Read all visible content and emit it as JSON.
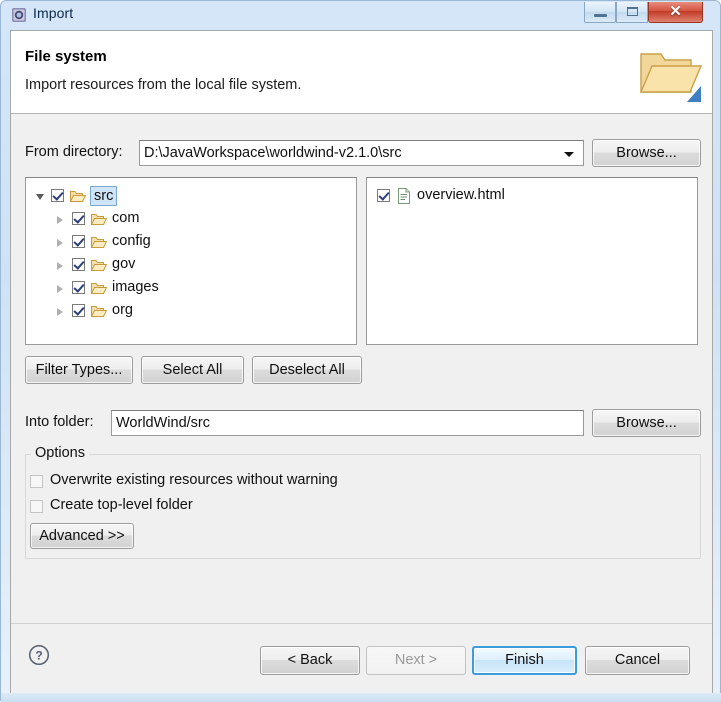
{
  "window": {
    "title": "Import",
    "icon": "import-wizard-icon",
    "controls": {
      "minimize": "minimize-button",
      "maximize": "maximize-button",
      "close_glyph": "✕"
    }
  },
  "header": {
    "title": "File system",
    "description": "Import resources from the local file system.",
    "icon": "open-folder-import-icon"
  },
  "source": {
    "label": "From directory:",
    "value": "D:\\JavaWorkspace\\worldwind-v2.1.0\\src",
    "placeholder": "",
    "browse_label": "Browse..."
  },
  "tree": {
    "items": [
      {
        "label": "src",
        "indent": 0,
        "checked": true,
        "expanded": true,
        "selected": true
      },
      {
        "label": "com",
        "indent": 1,
        "checked": true,
        "expanded": false,
        "selected": false
      },
      {
        "label": "config",
        "indent": 1,
        "checked": true,
        "expanded": false,
        "selected": false
      },
      {
        "label": "gov",
        "indent": 1,
        "checked": true,
        "expanded": false,
        "selected": false
      },
      {
        "label": "images",
        "indent": 1,
        "checked": true,
        "expanded": false,
        "selected": false
      },
      {
        "label": "org",
        "indent": 1,
        "checked": true,
        "expanded": false,
        "selected": false
      }
    ]
  },
  "file_list": {
    "items": [
      {
        "label": "overview.html",
        "checked": true
      }
    ]
  },
  "filter_buttons": {
    "filter_types": "Filter Types...",
    "select_all": "Select All",
    "deselect_all": "Deselect All"
  },
  "destination": {
    "label": "Into folder:",
    "value": "WorldWind/src",
    "placeholder": "",
    "browse_label": "Browse..."
  },
  "options": {
    "legend": "Options",
    "checkboxes": [
      {
        "label": "Overwrite existing resources without warning",
        "checked": false
      },
      {
        "label": "Create top-level folder",
        "checked": false
      }
    ],
    "advanced_label": "Advanced >>"
  },
  "footer": {
    "help": "?",
    "back": "< Back",
    "next": "Next >",
    "finish": "Finish",
    "cancel": "Cancel",
    "next_disabled": true,
    "finish_default": true
  },
  "colors": {
    "dialog_background": "#f0f0f0",
    "panel_background": "#ffffff",
    "title_gradient_top": "#d4e6f7",
    "close_button": "#c13a26",
    "default_button_border": "#3c9ddd",
    "selection": "#cfe4f7",
    "folder_yellow": "#f0c674"
  }
}
